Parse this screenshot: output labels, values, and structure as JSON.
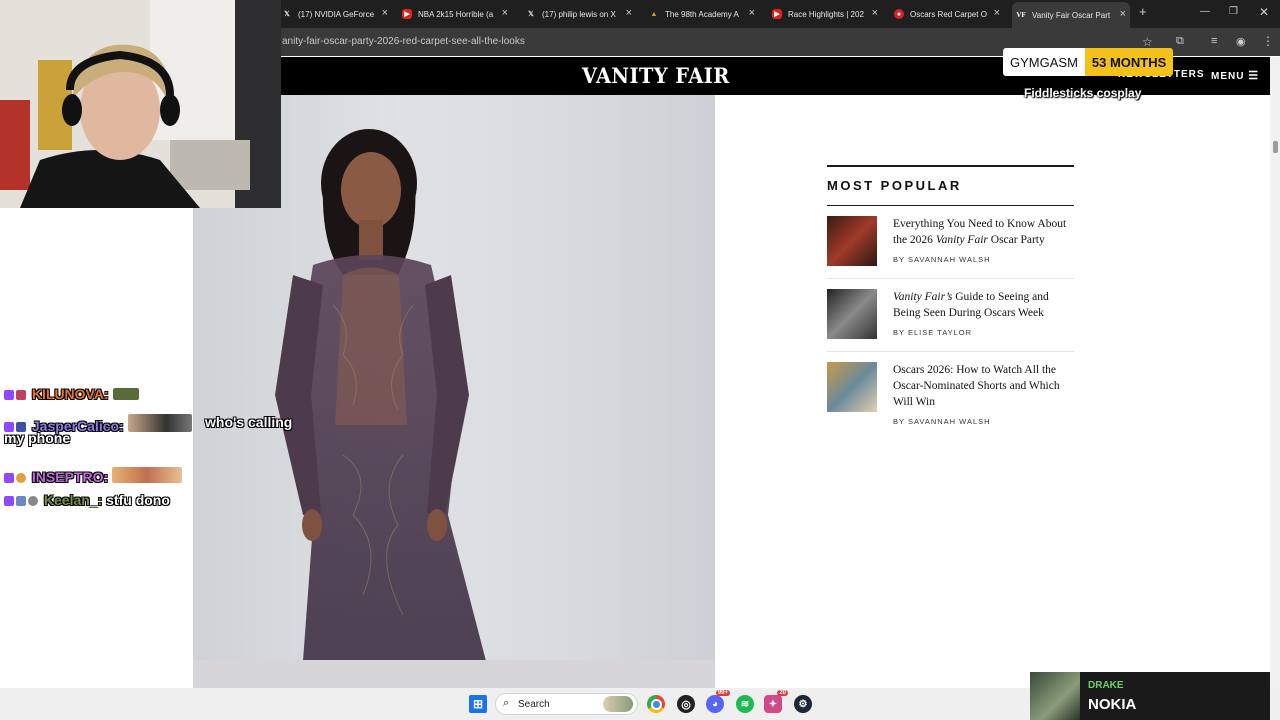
{
  "browser": {
    "tabs": [
      {
        "label": "(17) NVIDIA GeForce",
        "icon": "x-icon"
      },
      {
        "label": "NBA 2k15 Horrible (a",
        "icon": "youtube-icon"
      },
      {
        "label": "(17) philip lewis on X",
        "icon": "x-icon"
      },
      {
        "label": "The 98th Academy A",
        "icon": "academy-icon"
      },
      {
        "label": "Race Highlights | 202",
        "icon": "youtube-icon"
      },
      {
        "label": "Oscars Red Carpet O",
        "icon": "site-icon"
      },
      {
        "label": "Vanity Fair Oscar Part",
        "icon": "vf-icon",
        "active": true
      }
    ],
    "url": "anity-fair-oscar-party-2026-red-carpet-see-all-the-looks"
  },
  "page": {
    "logo": "VANITY FAIR",
    "nav_newsletters": "NEWSLETTERS",
    "nav_menu": "MENU",
    "most_popular": {
      "title": "MOST POPULAR",
      "items": [
        {
          "headline_a": "Everything You Need to Know About the 2026 ",
          "headline_em": "Vanity Fair",
          "headline_b": " Oscar Party",
          "byline": "BY SAVANNAH WALSH"
        },
        {
          "headline_a": "",
          "headline_em": "Vanity Fair’s",
          "headline_b": " Guide to Seeing and Being Seen During Oscars Week",
          "byline": "BY ELISE TAYLOR"
        },
        {
          "headline_a": "Oscars 2026: How to Watch All the Oscar-Nominated Shorts and Which Will Win",
          "headline_em": "",
          "headline_b": "",
          "byline": "BY SAVANNAH WALSH"
        }
      ]
    }
  },
  "overlay": {
    "sub_name": "GYMGASM",
    "sub_months": "53 MONTHS",
    "sub_message": "Fiddlesticks cosplay",
    "chat": [
      {
        "user": "KILUNOVA:",
        "color": "#e8732c",
        "text": ""
      },
      {
        "user": "JasperCalico:",
        "color": "#8f7de6",
        "text": "who's calling my phone"
      },
      {
        "user": "INSEPTRO:",
        "color": "#c46be0",
        "text": ""
      },
      {
        "user": "Keelan_:",
        "color": "#7a8f4a",
        "text": "stfu dono"
      }
    ]
  },
  "taskbar": {
    "search_label": "Search",
    "discord_badge": "99+",
    "steam_badge": "20"
  },
  "now_playing": {
    "artist": "DRAKE",
    "song": "NOKIA"
  }
}
